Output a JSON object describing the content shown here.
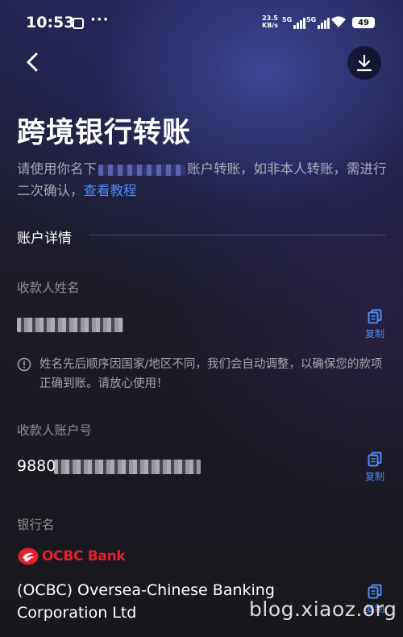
{
  "status_bar": {
    "time": "10:53",
    "speed_value": "23.5",
    "speed_unit": "KB/s",
    "network_1": "5G",
    "network_2": "5G",
    "battery": "49"
  },
  "header": {
    "title": "跨境银行转账"
  },
  "intro": {
    "text_before": "请使用你名下",
    "text_after": "账户转账，如非本人转账，需进行二次确认，",
    "link": "查看教程"
  },
  "section": {
    "title": "账户详情"
  },
  "fields": {
    "payee_name_label": "收款人姓名",
    "payee_account_label": "收款人账户号",
    "payee_account_prefix": "9880",
    "bank_name_label": "银行名",
    "bank_name": "(OCBC) Oversea-Chinese Banking Corporation Ltd",
    "copy_label": "复制"
  },
  "notice": {
    "text": "姓名先后顺序因国家/地区不同，我们会自动调整，以确保您的款项正确到账。请放心使用！"
  },
  "bank_logo": {
    "text": "OCBC Bank",
    "color": "#e3202b"
  },
  "watermark": "blog.xiaoz.org",
  "colors": {
    "accent": "#4e8df5",
    "background": "#16161c"
  }
}
